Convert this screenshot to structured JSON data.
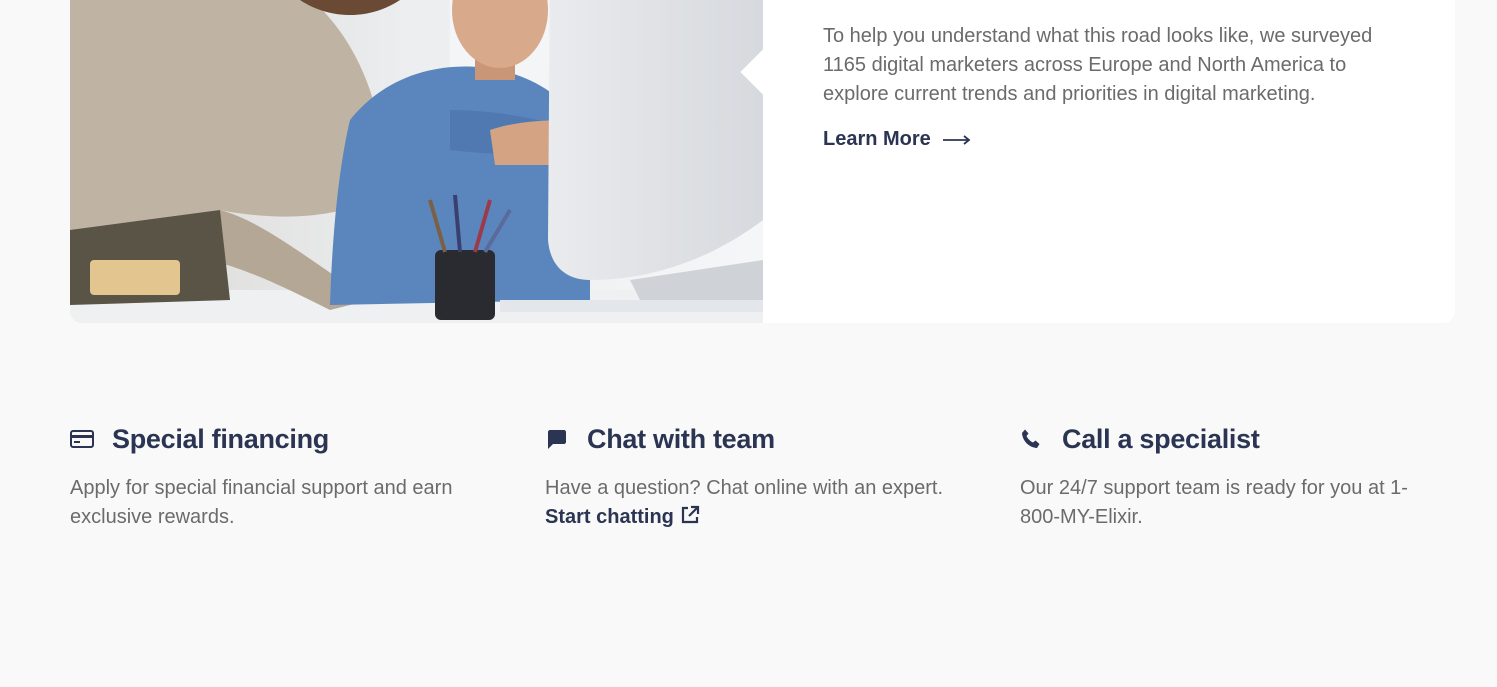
{
  "card": {
    "body": "To help you understand what this road looks like, we surveyed 1165 digital marketers across Europe and North America to explore current trends and priorities in digital marketing.",
    "learn_more_label": "Learn More",
    "arrow_icon": "long-arrow-right-icon"
  },
  "features": [
    {
      "icon": "credit-card-icon",
      "title": "Special financing",
      "description": "Apply for special financial support and earn exclusive rewards."
    },
    {
      "icon": "chat-bubble-icon",
      "title": "Chat with team",
      "description": "Have a question? Chat online with an expert.",
      "link_label": "Start chatting",
      "link_icon": "external-link-icon"
    },
    {
      "icon": "phone-icon",
      "title": "Call a specialist",
      "description": "Our 24/7 support team is ready for you at 1-800-MY-Elixir."
    }
  ],
  "colors": {
    "page_background": "#f9f9f9",
    "card_background": "#ffffff",
    "heading": "#2b3553",
    "body_text": "#6b6b6b"
  }
}
